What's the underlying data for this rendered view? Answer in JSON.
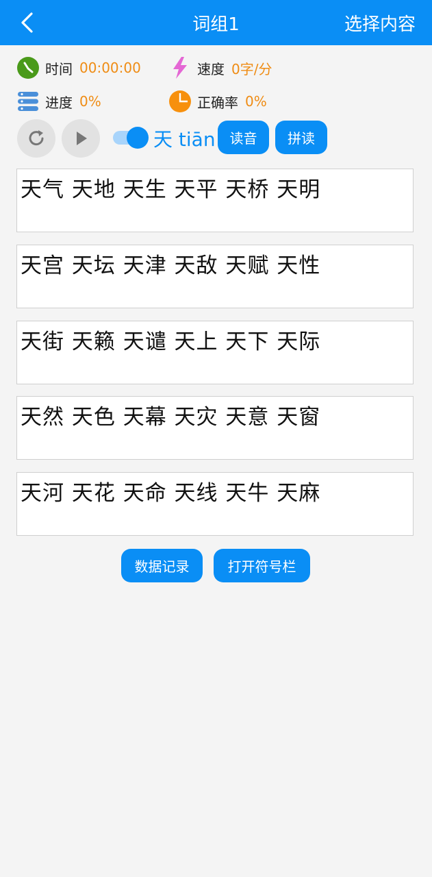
{
  "header": {
    "title": "词组1",
    "right_action": "选择内容",
    "background": "#0a8ef5"
  },
  "stats": {
    "time_label": "时间",
    "time_value": "00:00:00",
    "speed_label": "速度",
    "speed_value": "0字/分",
    "progress_label": "进度",
    "progress_value": "0%",
    "accuracy_label": "正确率",
    "accuracy_value": "0%"
  },
  "controls": {
    "reset_icon": "refresh-icon",
    "play_icon": "play-icon",
    "toggle_on": true,
    "char_display": "天 tiān",
    "read_sound_label": "读音",
    "spell_read_label": "拼读"
  },
  "word_groups": [
    "天气 天地 天生 天平 天桥 天明",
    "天宫 天坛 天津 天敌 天赋 天性",
    "天街 天籁 天谴 天上 天下 天际",
    "天然 天色 天幕 天灾 天意 天窗",
    "天河 天花 天命 天线 天牛 天麻"
  ],
  "footer": {
    "data_record_label": "数据记录",
    "symbol_bar_label": "打开符号栏"
  },
  "colors": {
    "accent": "#0a8ef5",
    "value_orange": "#ef8c14"
  }
}
